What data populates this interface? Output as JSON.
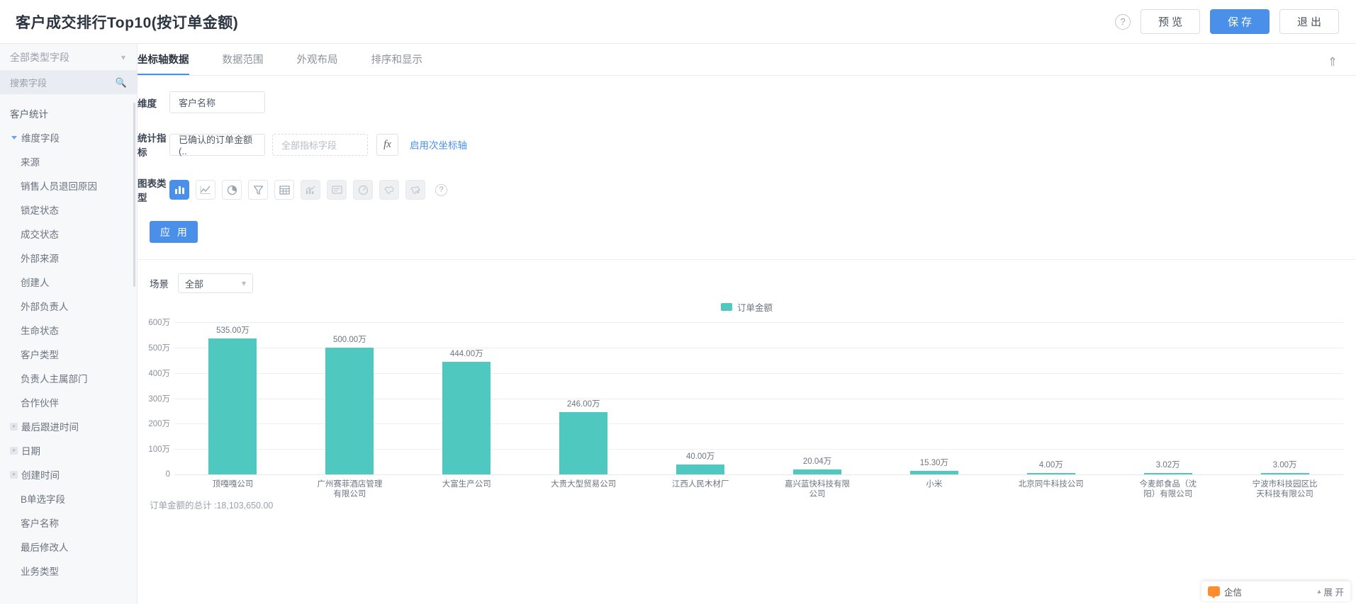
{
  "header": {
    "title": "客户成交排行Top10(按订单金额)",
    "help_icon": "question-circle-icon",
    "buttons": [
      {
        "label": "预览",
        "style": "default"
      },
      {
        "label": "保存",
        "style": "primary"
      },
      {
        "label": "退出",
        "style": "default"
      }
    ]
  },
  "sidebar": {
    "type_filter": "全部类型字段",
    "type_filter_icon": "chevron-down-icon",
    "search_placeholder": "搜索字段",
    "search_icon": "search-icon",
    "items": [
      {
        "label": "客户统计",
        "kind": "group"
      },
      {
        "label": "维度字段",
        "kind": "expanded"
      },
      {
        "label": "来源",
        "kind": "field"
      },
      {
        "label": "销售人员退回原因",
        "kind": "field"
      },
      {
        "label": "锁定状态",
        "kind": "field"
      },
      {
        "label": "成交状态",
        "kind": "field"
      },
      {
        "label": "外部来源",
        "kind": "field"
      },
      {
        "label": "创建人",
        "kind": "field"
      },
      {
        "label": "外部负责人",
        "kind": "field"
      },
      {
        "label": "生命状态",
        "kind": "field"
      },
      {
        "label": "客户类型",
        "kind": "field"
      },
      {
        "label": "负责人主属部门",
        "kind": "field"
      },
      {
        "label": "合作伙伴",
        "kind": "field"
      },
      {
        "label": "最后跟进时间",
        "kind": "collapsed"
      },
      {
        "label": "日期",
        "kind": "collapsed"
      },
      {
        "label": "创建时间",
        "kind": "collapsed"
      },
      {
        "label": "B单选字段",
        "kind": "field"
      },
      {
        "label": "客户名称",
        "kind": "field"
      },
      {
        "label": "最后修改人",
        "kind": "field"
      },
      {
        "label": "业务类型",
        "kind": "field"
      }
    ]
  },
  "main": {
    "tabs": [
      {
        "label": "坐标轴数据",
        "active": true
      },
      {
        "label": "数据范围",
        "active": false
      },
      {
        "label": "外观布局",
        "active": false
      },
      {
        "label": "排序和显示",
        "active": false
      }
    ],
    "collapse_icon": "chevron-double-up-icon",
    "form": {
      "dimension_label": "维度",
      "dimension_value": "客户名称",
      "metric_label": "统计指标",
      "metric_value": "已确认的订单金额(..",
      "metric_placeholder": "全部指标字段",
      "fx_label": "fx",
      "secondary_axis_link": "启用次坐标轴",
      "chart_type_label": "图表类型",
      "chart_types": [
        {
          "name": "bar-chart-icon",
          "state": "active"
        },
        {
          "name": "line-chart-icon",
          "state": "normal"
        },
        {
          "name": "pie-chart-icon",
          "state": "normal"
        },
        {
          "name": "funnel-chart-icon",
          "state": "normal"
        },
        {
          "name": "table-icon",
          "state": "normal"
        },
        {
          "name": "combo-chart-icon",
          "state": "disabled"
        },
        {
          "name": "card-icon",
          "state": "disabled"
        },
        {
          "name": "gauge-icon",
          "state": "disabled"
        },
        {
          "name": "map-icon",
          "state": "disabled"
        },
        {
          "name": "map-bubble-icon",
          "state": "disabled"
        }
      ],
      "chart_type_help_icon": "question-circle-icon",
      "apply_label": "应 用"
    },
    "scene": {
      "label": "场景",
      "value": "全部",
      "icon": "chevron-down-icon"
    },
    "footer_total": "订单金额的总计 :18,103,650.00"
  },
  "floating_widget": {
    "label": "企信",
    "logo_icon": "qixin-logo-icon",
    "expand_label": "展 开",
    "expand_icon": "chevron-up-icon"
  },
  "colors": {
    "primary": "#4a90e8",
    "bar": "#4fc9c0",
    "text": "#2b3440",
    "muted": "#8a919b"
  },
  "chart_data": {
    "type": "bar",
    "title": "",
    "legend": [
      "订单金额"
    ],
    "legend_position": "top-center",
    "xlabel": "",
    "ylabel": "",
    "ylim": [
      0,
      6000000
    ],
    "grid": true,
    "ytick_labels": [
      "0",
      "100万",
      "200万",
      "300万",
      "400万",
      "500万",
      "600万"
    ],
    "ytick_values": [
      0,
      1000000,
      2000000,
      3000000,
      4000000,
      5000000,
      6000000
    ],
    "categories": [
      "顶嘎嘎公司",
      "广州赛菲酒店管理有限公司",
      "大富生产公司",
      "大贵大型贸易公司",
      "江西人民木材厂",
      "嘉兴蓝快科技有限公司",
      "小米",
      "北京同牛科技公司",
      "今麦郎食品（沈阳）有限公司",
      "宁波市科技园区比天科技有限公司"
    ],
    "values": [
      5350000,
      5000000,
      4440000,
      2460000,
      400000,
      200400,
      153000,
      40000,
      30200,
      30000
    ],
    "data_labels": [
      "535.00万",
      "500.00万",
      "444.00万",
      "246.00万",
      "40.00万",
      "20.04万",
      "15.30万",
      "4.00万",
      "3.02万",
      "3.00万"
    ],
    "series": [
      {
        "name": "订单金额",
        "color": "#4fc9c0",
        "values": [
          5350000,
          5000000,
          4440000,
          2460000,
          400000,
          200400,
          153000,
          40000,
          30200,
          30000
        ]
      }
    ]
  }
}
